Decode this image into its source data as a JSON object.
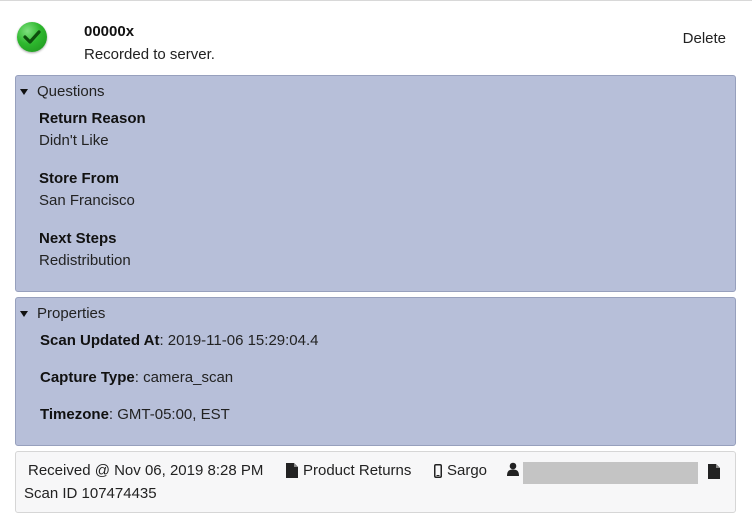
{
  "record": {
    "id": "00000x",
    "status": "Recorded to server.",
    "delete_label": "Delete",
    "status_icon": "check-circle-icon"
  },
  "questions": {
    "title": "Questions",
    "items": [
      {
        "label": "Return Reason",
        "value": "Didn't Like"
      },
      {
        "label": "Store From",
        "value": "San Francisco"
      },
      {
        "label": "Next Steps",
        "value": "Redistribution"
      }
    ]
  },
  "properties": {
    "title": "Properties",
    "items": [
      {
        "label": "Scan Updated At",
        "value": ": 2019-11-06 15:29:04.4"
      },
      {
        "label": "Capture Type",
        "value": ": camera_scan"
      },
      {
        "label": "Timezone",
        "value": ": GMT-05:00, EST"
      }
    ]
  },
  "footer": {
    "received": "Received @ Nov 06, 2019 8:28 PM",
    "workflow": "Product Returns",
    "device": "Sargo",
    "scan_id": "Scan ID 107474435"
  },
  "colors": {
    "panel_bg": "#b7bfd9",
    "panel_border": "#97a0bd",
    "success_green": "#2eb82e"
  }
}
